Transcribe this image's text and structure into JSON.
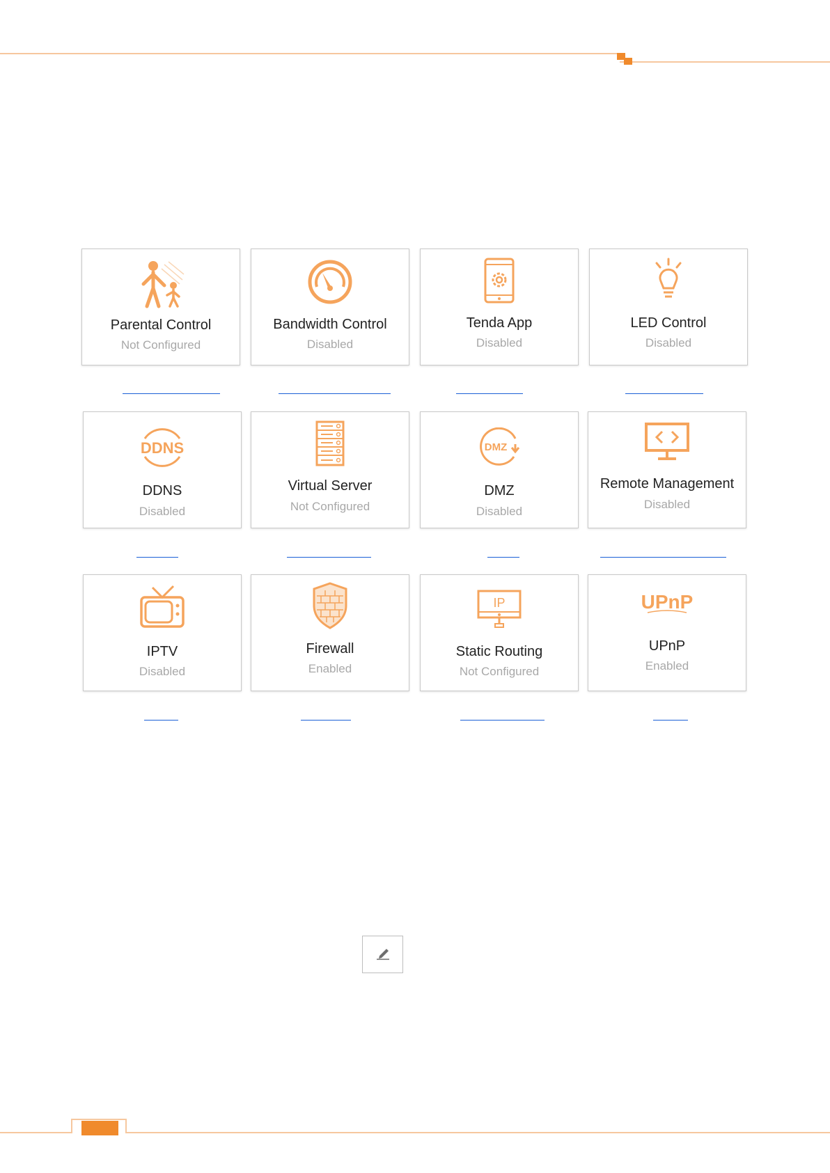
{
  "accent_color": "#F5A45C",
  "brand_color": "#F08A2C",
  "link_color": "#1A5FD6",
  "page_number": "",
  "cards": [
    {
      "title": "Parental Control",
      "status": "Not Configured",
      "icon": "parental-control-icon"
    },
    {
      "title": "Bandwidth Control",
      "status": "Disabled",
      "icon": "speedometer-icon"
    },
    {
      "title": "Tenda App",
      "status": "Disabled",
      "icon": "phone-gear-icon"
    },
    {
      "title": "LED Control",
      "status": "Disabled",
      "icon": "lightbulb-icon"
    },
    {
      "title": "DDNS",
      "status": "Disabled",
      "icon": "ddns-icon"
    },
    {
      "title": "Virtual Server",
      "status": "Not Configured",
      "icon": "server-rack-icon"
    },
    {
      "title": "DMZ",
      "status": "Disabled",
      "icon": "dmz-icon"
    },
    {
      "title": "Remote Management",
      "status": "Disabled",
      "icon": "monitor-code-icon"
    },
    {
      "title": "IPTV",
      "status": "Disabled",
      "icon": "tv-icon"
    },
    {
      "title": "Firewall",
      "status": "Enabled",
      "icon": "firewall-shield-icon"
    },
    {
      "title": "Static Routing",
      "status": "Not Configured",
      "icon": "monitor-ip-icon"
    },
    {
      "title": "UPnP",
      "status": "Enabled",
      "icon": "upnp-icon"
    }
  ],
  "edit_button": {
    "icon": "pencil-icon"
  }
}
